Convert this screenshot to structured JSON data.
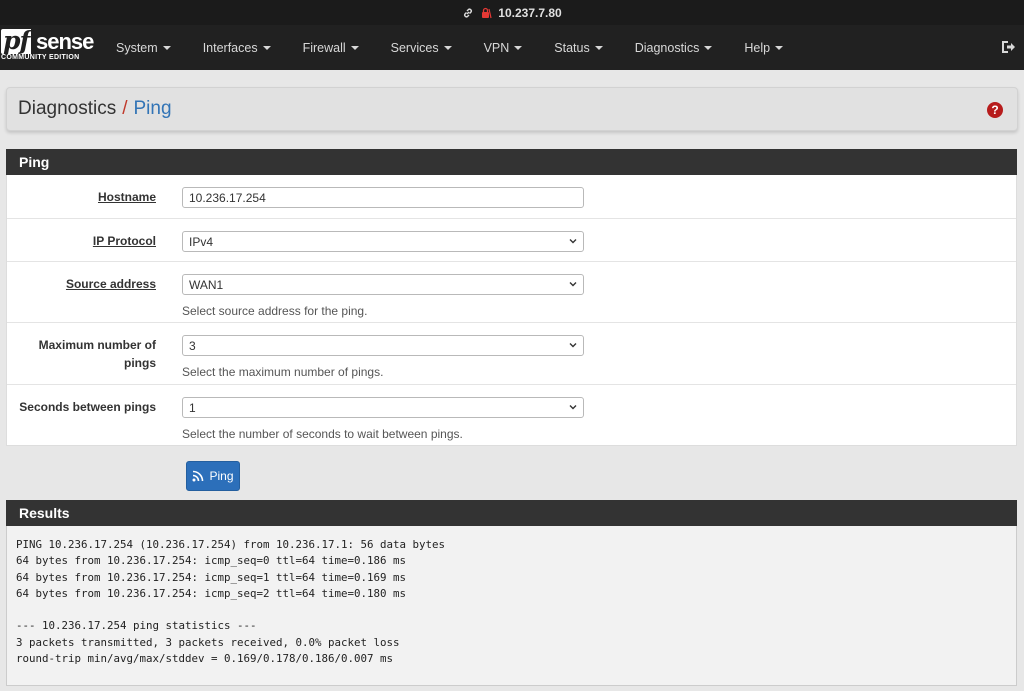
{
  "addressbar": {
    "url": "10.237.7.80",
    "icons": [
      "link-icon",
      "lock-warning-icon"
    ]
  },
  "navbar": {
    "logo": {
      "primary": "pf",
      "secondary": "sense",
      "tagline": "COMMUNITY EDITION"
    },
    "items": [
      {
        "label": "System"
      },
      {
        "label": "Interfaces"
      },
      {
        "label": "Firewall"
      },
      {
        "label": "Services"
      },
      {
        "label": "VPN"
      },
      {
        "label": "Status"
      },
      {
        "label": "Diagnostics"
      },
      {
        "label": "Help"
      }
    ],
    "logout_icon": "sign-out-icon"
  },
  "page_header": {
    "parent": "Diagnostics",
    "separator": "/",
    "current": "Ping",
    "help_icon": "question-circle-icon",
    "help_glyph": "?"
  },
  "ping_panel": {
    "title": "Ping",
    "fields": {
      "hostname": {
        "label": "Hostname",
        "value": "10.236.17.254"
      },
      "ip_protocol": {
        "label": "IP Protocol",
        "value": "IPv4"
      },
      "source_address": {
        "label": "Source address",
        "value": "WAN1",
        "help": "Select source address for the ping."
      },
      "max_pings": {
        "label": "Maximum number of pings",
        "value": "3",
        "help": "Select the maximum number of pings."
      },
      "seconds_between": {
        "label": "Seconds between pings",
        "value": "1",
        "help": "Select the number of seconds to wait between pings."
      }
    },
    "button": {
      "label": "Ping",
      "icon": "rss-icon"
    }
  },
  "results_panel": {
    "title": "Results",
    "output": "PING 10.236.17.254 (10.236.17.254) from 10.236.17.1: 56 data bytes\n64 bytes from 10.236.17.254: icmp_seq=0 ttl=64 time=0.186 ms\n64 bytes from 10.236.17.254: icmp_seq=1 ttl=64 time=0.169 ms\n64 bytes from 10.236.17.254: icmp_seq=2 ttl=64 time=0.180 ms\n\n--- 10.236.17.254 ping statistics ---\n3 packets transmitted, 3 packets received, 0.0% packet loss\nround-trip min/avg/max/stddev = 0.169/0.178/0.186/0.007 ms"
  },
  "colors": {
    "navbar_bg": "#212121",
    "panel_head_bg": "#333333",
    "accent_blue": "#3274b6",
    "button_blue": "#2c6fba",
    "separator_red": "#c0392b",
    "help_red": "#b71c1c"
  }
}
